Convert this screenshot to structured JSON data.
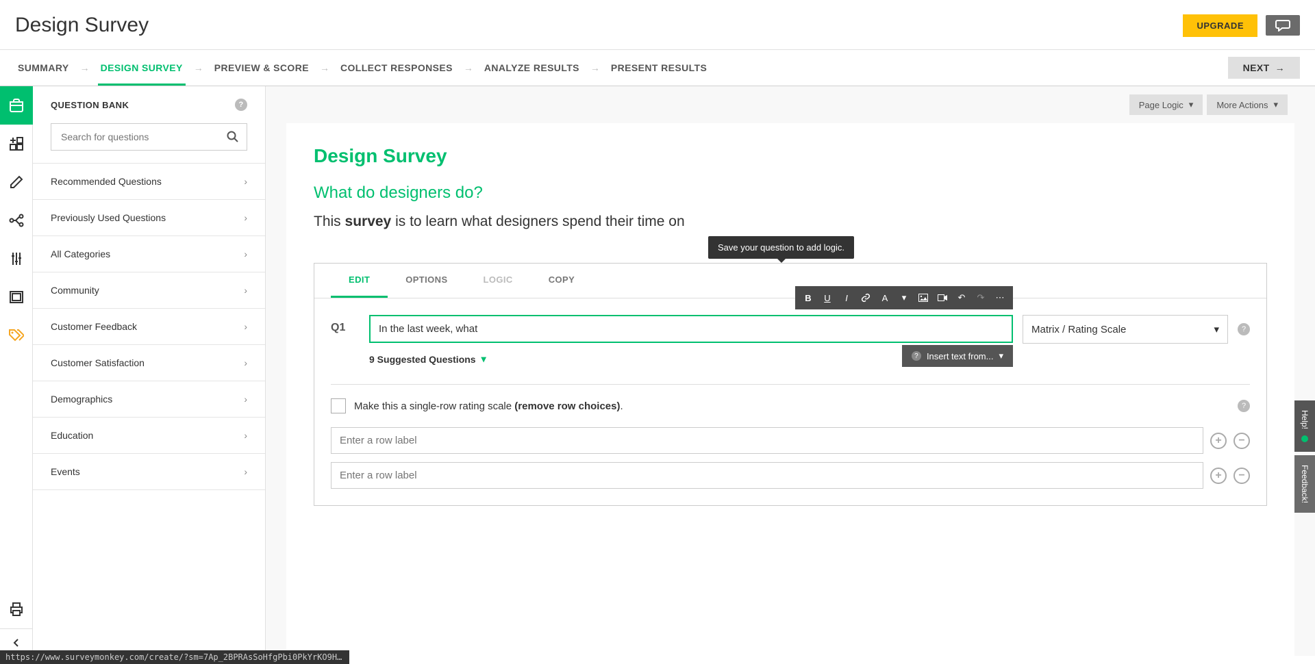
{
  "header": {
    "title": "Design Survey",
    "upgrade_label": "UPGRADE"
  },
  "breadcrumb": {
    "items": [
      "SUMMARY",
      "DESIGN SURVEY",
      "PREVIEW & SCORE",
      "COLLECT RESPONSES",
      "ANALYZE RESULTS",
      "PRESENT RESULTS"
    ],
    "active_index": 1,
    "next_label": "NEXT"
  },
  "sidebar": {
    "title": "QUESTION BANK",
    "search_placeholder": "Search for questions",
    "categories": [
      "Recommended Questions",
      "Previously Used Questions",
      "All Categories",
      "Community",
      "Customer Feedback",
      "Customer Satisfaction",
      "Demographics",
      "Education",
      "Events"
    ]
  },
  "canvas": {
    "page_logic_label": "Page Logic",
    "more_actions_label": "More Actions",
    "survey_title": "Design Survey",
    "survey_subtitle": "What do designers do?",
    "survey_desc_prefix": "This ",
    "survey_desc_bold": "survey",
    "survey_desc_suffix": " is to learn what designers spend their time on"
  },
  "question": {
    "tabs": [
      "EDIT",
      "OPTIONS",
      "LOGIC",
      "COPY"
    ],
    "active_tab": 0,
    "logic_tooltip": "Save your question to add logic.",
    "label": "Q1",
    "text": "In the last week, what",
    "type_selected": "Matrix / Rating Scale",
    "insert_text_label": "Insert text from...",
    "suggested_label": "9 Suggested Questions",
    "single_row_prefix": "Make this a single-row rating scale ",
    "single_row_bold": "(remove row choices)",
    "single_row_suffix": ".",
    "row_placeholder": "Enter a row label"
  },
  "side_tabs": {
    "help": "Help!",
    "feedback": "Feedback!"
  },
  "status_url": "https://www.surveymonkey.com/create/?sm=7Ap_2BPRAsSoHfgPbi0PkYrKO9H..."
}
